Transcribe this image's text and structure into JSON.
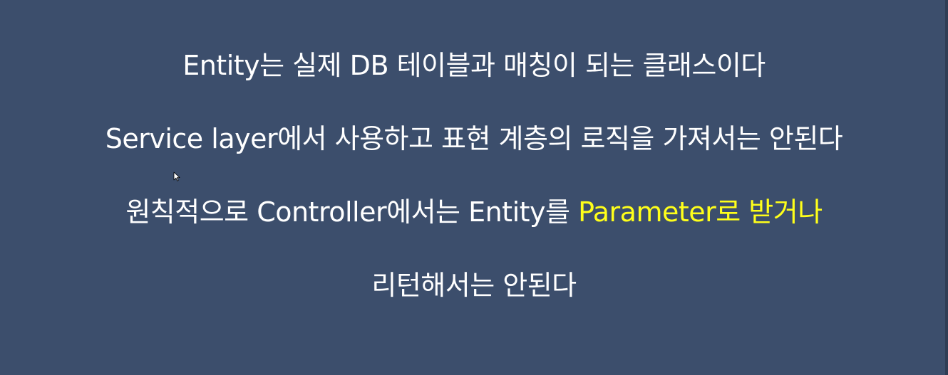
{
  "slide": {
    "lines": [
      {
        "text": "Entity는 실제 DB 테이블과 매칭이 되는 클래스이다"
      },
      {
        "text": "Service layer에서 사용하고 표현 계층의 로직을 가져서는 안된다"
      },
      {
        "prefix": "원칙적으로 Controller에서는 Entity를 ",
        "highlight": "Parameter로 받거나"
      },
      {
        "text": "리턴해서는 안된다"
      }
    ]
  },
  "colors": {
    "background": "#3c4e6c",
    "text": "#ffffff",
    "highlight": "#ffff1a"
  },
  "icons": {
    "cursor": "mouse-pointer-icon"
  }
}
